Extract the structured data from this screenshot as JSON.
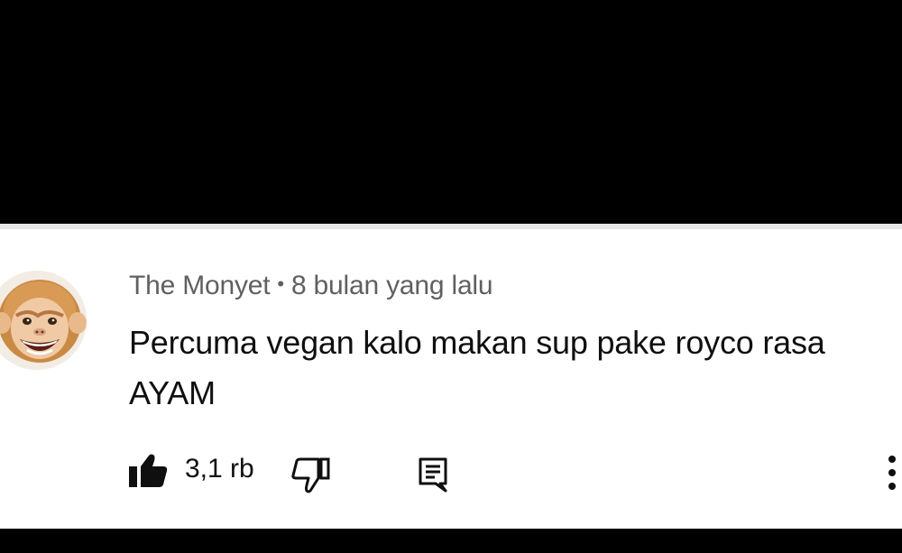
{
  "comment": {
    "author": "The Monyet",
    "separator": "•",
    "time": "8 bulan yang lalu",
    "text": "Percuma vegan kalo makan sup pake royco rasa AYAM",
    "avatar_icon": "monkey-avatar"
  },
  "actions": {
    "like_icon": "thumbs-up-filled-icon",
    "like_count": "3,1 rb",
    "dislike_icon": "thumbs-down-outline-icon",
    "reply_icon": "comment-reply-icon",
    "more_icon": "vertical-dots-icon"
  },
  "colors": {
    "background_top": "#000000",
    "card": "#ffffff",
    "meta_text": "#606060",
    "text": "#0f0f0f",
    "divider": "#e6e6e6"
  }
}
